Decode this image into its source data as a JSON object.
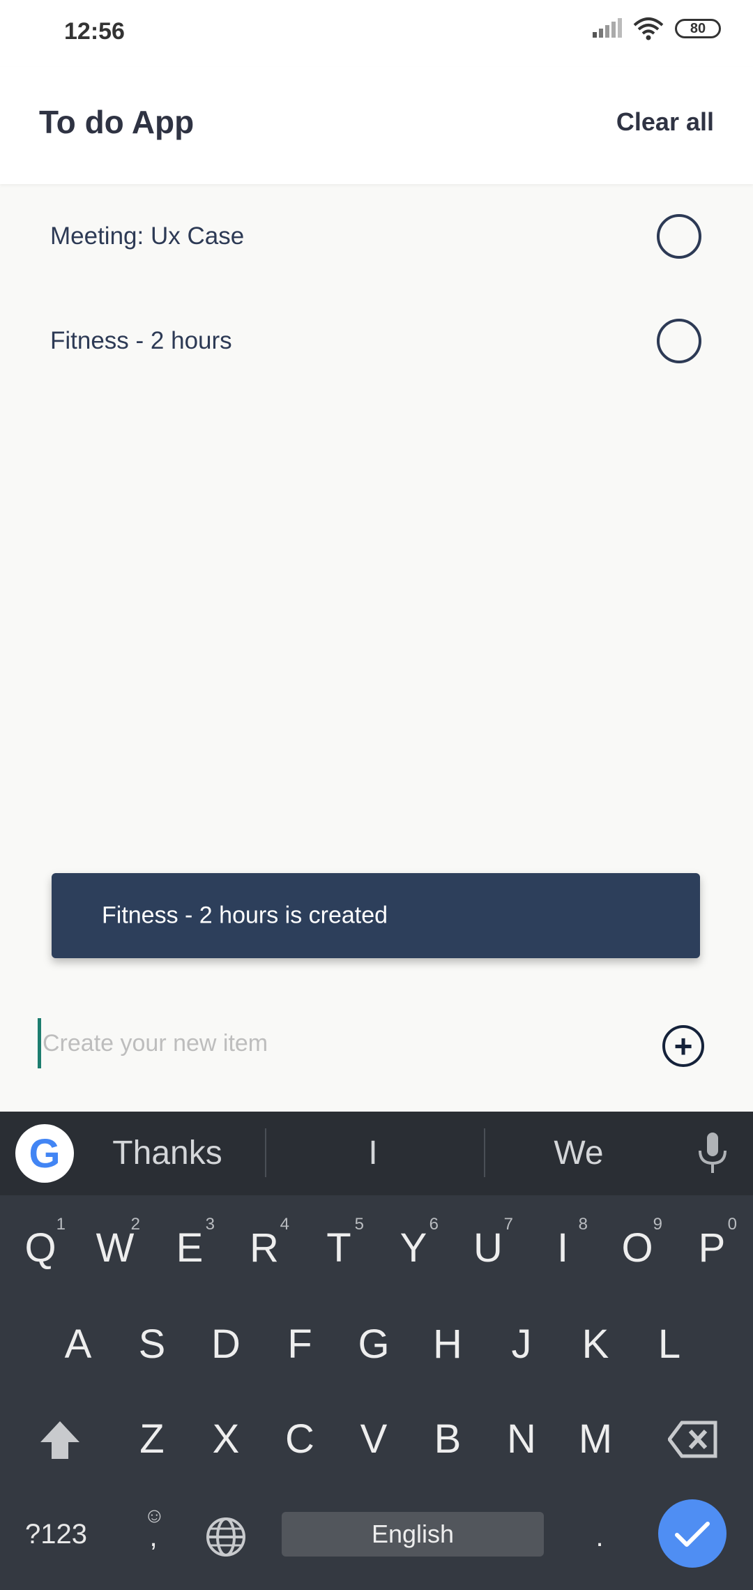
{
  "status_bar": {
    "time": "12:56",
    "battery": "80"
  },
  "app": {
    "title": "To do App",
    "clear_all_label": "Clear all"
  },
  "todos": [
    {
      "label": "Meeting: Ux Case"
    },
    {
      "label": "Fitness - 2 hours"
    }
  ],
  "snackbar": {
    "message": "Fitness - 2 hours is created"
  },
  "input": {
    "placeholder": "Create your new item",
    "value": ""
  },
  "keyboard": {
    "suggestions": [
      "Thanks",
      "I",
      "We"
    ],
    "row1": [
      {
        "key": "Q",
        "hint": "1"
      },
      {
        "key": "W",
        "hint": "2"
      },
      {
        "key": "E",
        "hint": "3"
      },
      {
        "key": "R",
        "hint": "4"
      },
      {
        "key": "T",
        "hint": "5"
      },
      {
        "key": "Y",
        "hint": "6"
      },
      {
        "key": "U",
        "hint": "7"
      },
      {
        "key": "I",
        "hint": "8"
      },
      {
        "key": "O",
        "hint": "9"
      },
      {
        "key": "P",
        "hint": "0"
      }
    ],
    "row2": [
      "A",
      "S",
      "D",
      "F",
      "G",
      "H",
      "J",
      "K",
      "L"
    ],
    "row3": [
      "Z",
      "X",
      "C",
      "V",
      "B",
      "N",
      "M"
    ],
    "symbols_label": "?123",
    "comma_label": ",",
    "period_label": ".",
    "space_label": "English",
    "g_logo_letter": "G"
  },
  "colors": {
    "snackbar": "#2d3f5b",
    "accent": "#4f8ef3",
    "text": "#2d3a55"
  }
}
